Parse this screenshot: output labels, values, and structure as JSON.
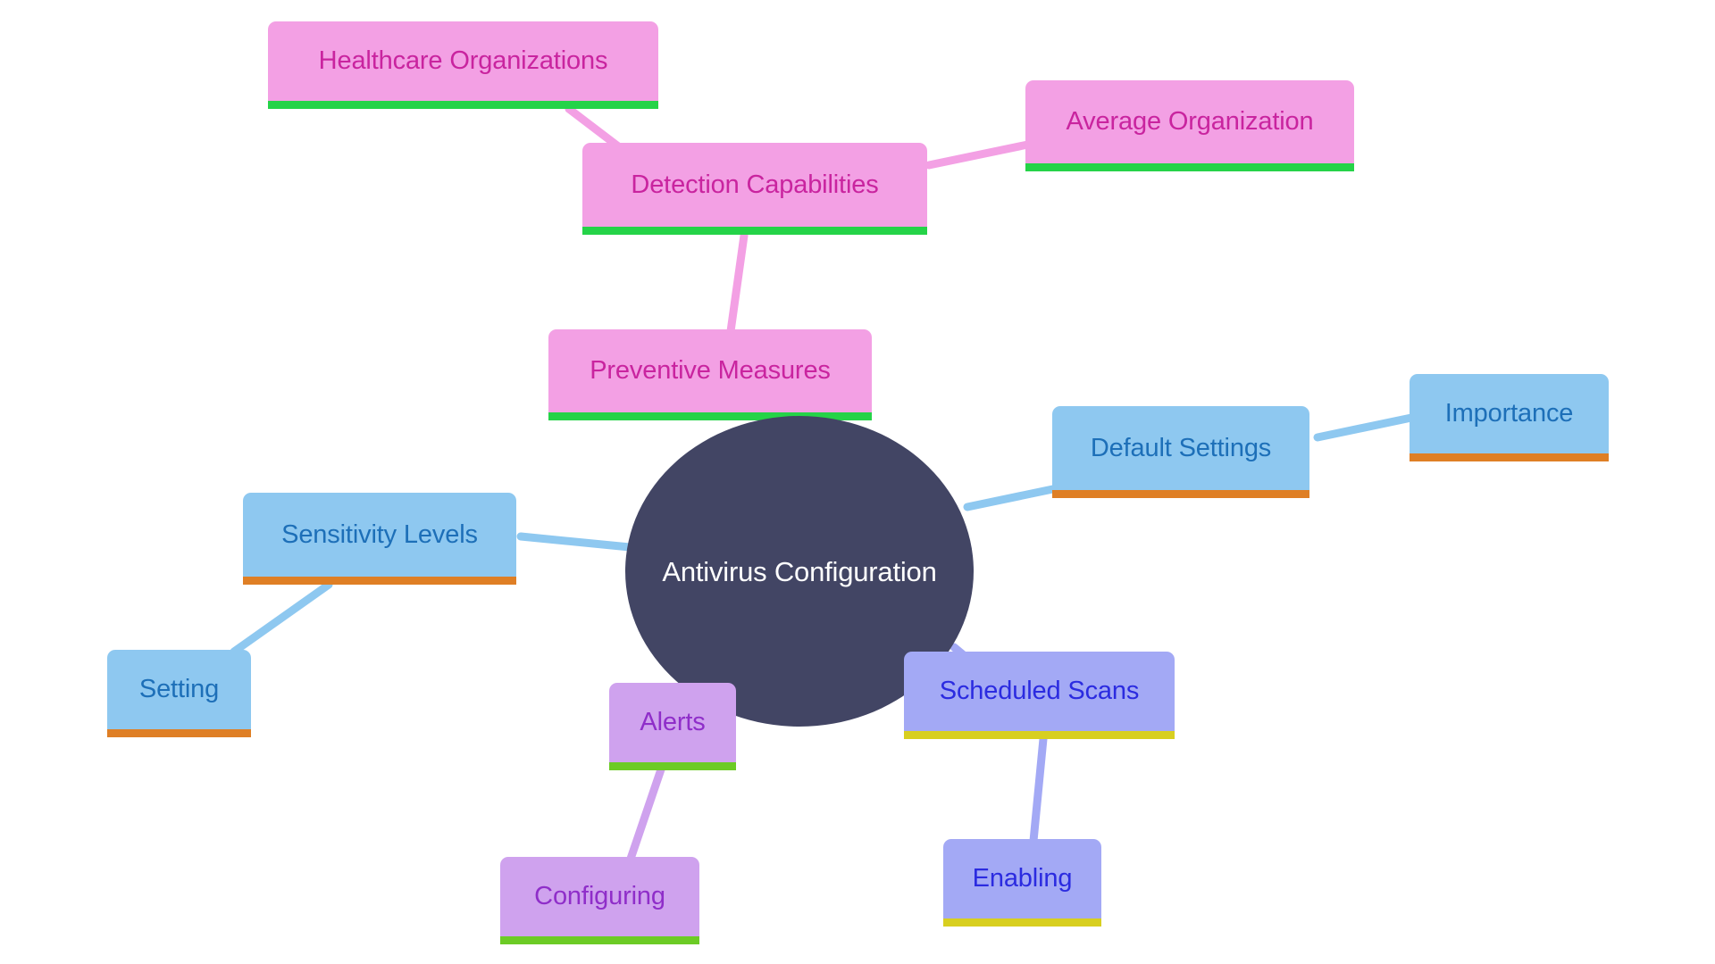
{
  "diagram": {
    "type": "mindmap",
    "title": "Antivirus Configuration",
    "background_color": "#ffffff",
    "root": {
      "id": "root",
      "label": "Antivirus Configuration",
      "shape": "ellipse",
      "fill_color": "#424564",
      "text_color": "#ffffff"
    },
    "palettes": {
      "pink": {
        "fill": "#f3a0e4",
        "text": "#c9249f",
        "underline": "#25d348",
        "edge": "#f3a0e4"
      },
      "blue": {
        "fill": "#8ec8f0",
        "text": "#1d6fb8",
        "underline": "#df7f25",
        "edge": "#8ec8f0"
      },
      "periwinkle": {
        "fill": "#a3a9f5",
        "text": "#2b2be0",
        "underline": "#d8cf20",
        "edge": "#a3a9f5"
      },
      "orchid": {
        "fill": "#cfa2ee",
        "text": "#8f2ec9",
        "underline": "#6ccb25",
        "edge": "#cfa2ee"
      }
    },
    "nodes": [
      {
        "id": "healthcare_organizations",
        "label": "Healthcare Organizations",
        "palette": "pink",
        "parent": "detection_capabilities"
      },
      {
        "id": "detection_capabilities",
        "label": "Detection Capabilities",
        "palette": "pink",
        "parent": "preventive_measures"
      },
      {
        "id": "average_organization",
        "label": "Average Organization",
        "palette": "pink",
        "parent": "detection_capabilities"
      },
      {
        "id": "preventive_measures",
        "label": "Preventive Measures",
        "palette": "pink",
        "parent": "root"
      },
      {
        "id": "default_settings",
        "label": "Default Settings",
        "palette": "blue",
        "parent": "root"
      },
      {
        "id": "importance",
        "label": "Importance",
        "palette": "blue",
        "parent": "default_settings"
      },
      {
        "id": "sensitivity_levels",
        "label": "Sensitivity Levels",
        "palette": "blue",
        "parent": "root"
      },
      {
        "id": "setting",
        "label": "Setting",
        "palette": "blue",
        "parent": "sensitivity_levels"
      },
      {
        "id": "scheduled_scans",
        "label": "Scheduled Scans",
        "palette": "periwinkle",
        "parent": "root"
      },
      {
        "id": "enabling",
        "label": "Enabling",
        "palette": "periwinkle",
        "parent": "scheduled_scans"
      },
      {
        "id": "alerts",
        "label": "Alerts",
        "palette": "orchid",
        "parent": "root"
      },
      {
        "id": "configuring",
        "label": "Configuring",
        "palette": "orchid",
        "parent": "alerts"
      }
    ],
    "edges": [
      {
        "from": "healthcare_organizations",
        "to": "detection_capabilities",
        "color": "#f3a0e4"
      },
      {
        "from": "detection_capabilities",
        "to": "average_organization",
        "color": "#f3a0e4"
      },
      {
        "from": "detection_capabilities",
        "to": "preventive_measures",
        "color": "#f3a0e4"
      },
      {
        "from": "preventive_measures",
        "to": "root",
        "color": "#f3a0e4"
      },
      {
        "from": "root",
        "to": "default_settings",
        "color": "#8ec8f0"
      },
      {
        "from": "default_settings",
        "to": "importance",
        "color": "#8ec8f0"
      },
      {
        "from": "root",
        "to": "sensitivity_levels",
        "color": "#8ec8f0"
      },
      {
        "from": "sensitivity_levels",
        "to": "setting",
        "color": "#8ec8f0"
      },
      {
        "from": "root",
        "to": "scheduled_scans",
        "color": "#a3a9f5"
      },
      {
        "from": "scheduled_scans",
        "to": "enabling",
        "color": "#a3a9f5"
      },
      {
        "from": "root",
        "to": "alerts",
        "color": "#cfa2ee"
      },
      {
        "from": "alerts",
        "to": "configuring",
        "color": "#cfa2ee"
      }
    ]
  }
}
